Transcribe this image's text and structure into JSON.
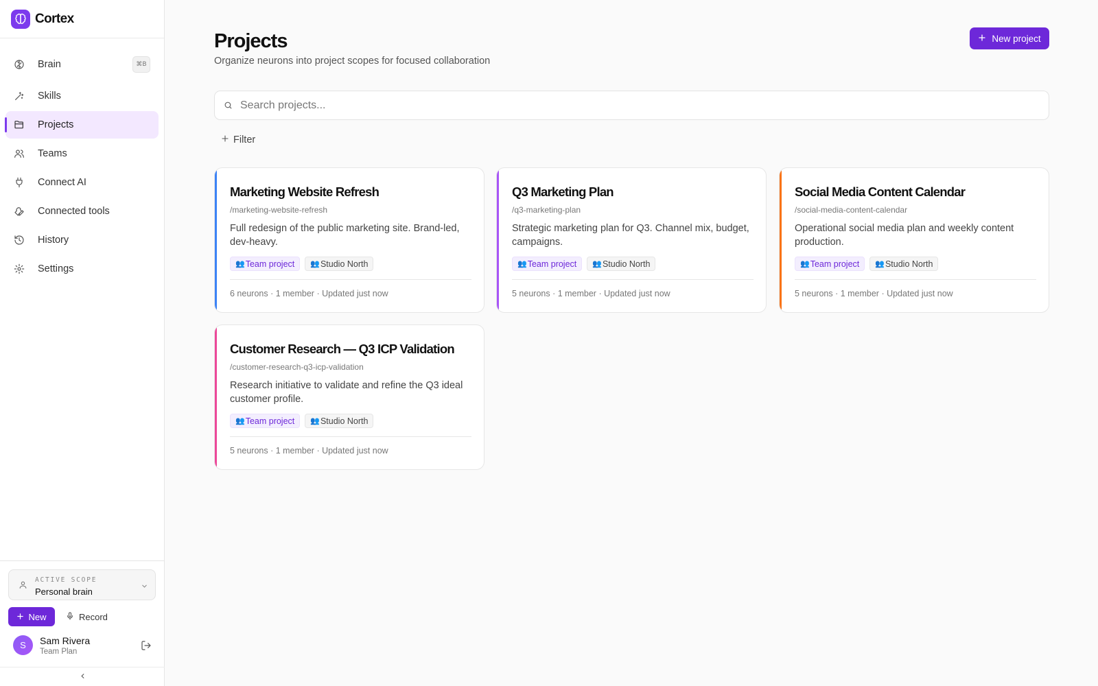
{
  "app": {
    "name": "Cortex",
    "accent": "#6d28d9"
  },
  "sidebar": {
    "items": [
      {
        "label": "Brain",
        "icon": "brain-icon",
        "shortcut": "⌘B"
      },
      {
        "label": "Skills",
        "icon": "wand-icon"
      },
      {
        "label": "Projects",
        "icon": "folder-icon",
        "active": true
      },
      {
        "label": "Teams",
        "icon": "users-icon"
      },
      {
        "label": "Connect AI",
        "icon": "plug-icon"
      },
      {
        "label": "Connected tools",
        "icon": "wrench-icon"
      },
      {
        "label": "History",
        "icon": "history-icon"
      },
      {
        "label": "Settings",
        "icon": "gear-icon"
      }
    ],
    "scope": {
      "caption": "ACTIVE SCOPE",
      "value": "Personal brain"
    },
    "new_label": "New",
    "record_label": "Record",
    "user": {
      "initial": "S",
      "name": "Sam Rivera",
      "plan": "Team Plan"
    }
  },
  "main": {
    "title": "Projects",
    "subtitle": "Organize neurons into project scopes for focused collaboration",
    "new_project_label": "New project",
    "search_placeholder": "Search projects...",
    "filter_label": "Filter",
    "projects": [
      {
        "title": "Marketing Website Refresh",
        "slug": "/marketing-website-refresh",
        "description": "Full redesign of the public marketing site. Brand-led, dev-heavy.",
        "tags": [
          {
            "glyph": "👥",
            "label": "Team project"
          },
          {
            "glyph": "👥",
            "label": "Studio North"
          }
        ],
        "meta": "6 neurons · 1 member · Updated just now",
        "accent": "#3b82f6"
      },
      {
        "title": "Q3 Marketing Plan",
        "slug": "/q3-marketing-plan",
        "description": "Strategic marketing plan for Q3. Channel mix, budget, campaigns.",
        "tags": [
          {
            "glyph": "👥",
            "label": "Team project"
          },
          {
            "glyph": "👥",
            "label": "Studio North"
          }
        ],
        "meta": "5 neurons · 1 member · Updated just now",
        "accent": "#a855f7"
      },
      {
        "title": "Social Media Content Calendar",
        "slug": "/social-media-content-calendar",
        "description": "Operational social media plan and weekly content production.",
        "tags": [
          {
            "glyph": "👥",
            "label": "Team project"
          },
          {
            "glyph": "👥",
            "label": "Studio North"
          }
        ],
        "meta": "5 neurons · 1 member · Updated just now",
        "accent": "#f97316"
      },
      {
        "title": "Customer Research — Q3 ICP Validation",
        "slug": "/customer-research-q3-icp-validation",
        "description": "Research initiative to validate and refine the Q3 ideal customer profile.",
        "tags": [
          {
            "glyph": "👥",
            "label": "Team project"
          },
          {
            "glyph": "👥",
            "label": "Studio North"
          }
        ],
        "meta": "5 neurons · 1 member · Updated just now",
        "accent": "#ec4899"
      }
    ]
  }
}
